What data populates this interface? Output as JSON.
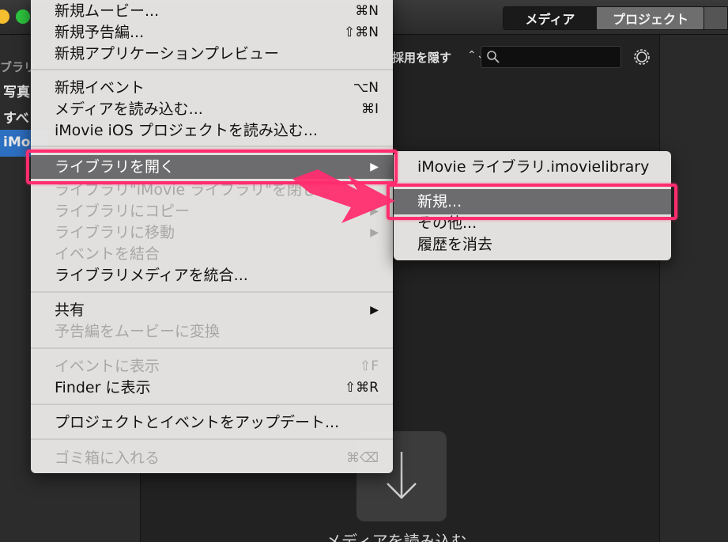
{
  "header": {
    "tab_media": "メディア",
    "tab_project": "プロジェクト"
  },
  "sidebar": {
    "heading": "ブラリ",
    "items": [
      "写真",
      "すべ"
    ],
    "selected": "iMo"
  },
  "toolbar": {
    "filter_label": "採用を隠す",
    "filter_chevron": "⌃⌄"
  },
  "content": {
    "import_label": "メディアを読み込む"
  },
  "file_menu": {
    "items": [
      {
        "label": "新規ムービー...",
        "shortcut": "⌘N"
      },
      {
        "label": "新規予告編...",
        "shortcut": "⇧⌘N"
      },
      {
        "label": "新規アプリケーションプレビュー",
        "shortcut": ""
      },
      {
        "label": "新規イベント",
        "shortcut": "⌥N"
      },
      {
        "label": "メディアを読み込む...",
        "shortcut": "⌘I"
      },
      {
        "label": "iMovie iOS プロジェクトを読み込む...",
        "shortcut": ""
      },
      {
        "label": "ライブラリを開く",
        "shortcut": "▶"
      },
      {
        "label": "ライブラリ\"iMovie ライブラリ\"を閉じる",
        "shortcut": ""
      },
      {
        "label": "ライブラリにコピー",
        "shortcut": "▶"
      },
      {
        "label": "ライブラリに移動",
        "shortcut": "▶"
      },
      {
        "label": "イベントを結合",
        "shortcut": ""
      },
      {
        "label": "ライブラリメディアを統合...",
        "shortcut": ""
      },
      {
        "label": "共有",
        "shortcut": "▶"
      },
      {
        "label": "予告編をムービーに変換",
        "shortcut": ""
      },
      {
        "label": "イベントに表示",
        "shortcut": "⇧F"
      },
      {
        "label": "Finder に表示",
        "shortcut": "⇧⌘R"
      },
      {
        "label": "プロジェクトとイベントをアップデート...",
        "shortcut": ""
      },
      {
        "label": "ゴミ箱に入れる",
        "shortcut": "⌘⌫"
      }
    ]
  },
  "submenu": {
    "items": [
      {
        "label": "iMovie ライブラリ.imovielibrary"
      },
      {
        "label": "新規..."
      },
      {
        "label": "その他..."
      },
      {
        "label": "履歴を消去"
      }
    ]
  },
  "colors": {
    "highlight_annotation": "#ff2d6f",
    "menu_selection": "#6c6c6e",
    "sidebar_selection": "#2d6fc1"
  }
}
